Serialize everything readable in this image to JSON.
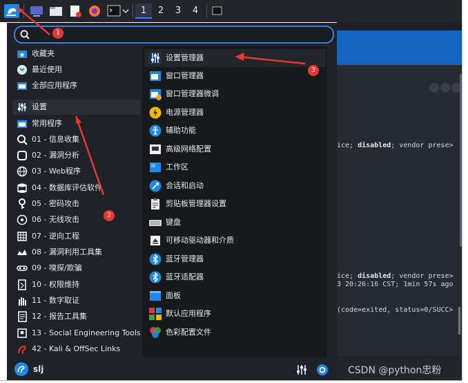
{
  "panel": {
    "workspaces": [
      "1",
      "2",
      "3",
      "4"
    ]
  },
  "search": {
    "placeholder": "",
    "value": ""
  },
  "categories": [
    {
      "label": "收藏夹",
      "icon": "star-folder-icon"
    },
    {
      "label": "最近使用",
      "icon": "recent-icon"
    },
    {
      "label": "全部应用程序",
      "icon": "all-apps-icon"
    },
    {
      "label": "设置",
      "icon": "settings-sliders-icon"
    },
    {
      "label": "常用程序",
      "icon": "common-apps-icon"
    },
    {
      "label": "01 - 信息收集",
      "icon": "magnifier-icon"
    },
    {
      "label": "02 - 漏洞分析",
      "icon": "vuln-icon"
    },
    {
      "label": "03 - Web程序",
      "icon": "web-icon"
    },
    {
      "label": "04 - 数据库评估软件",
      "icon": "database-icon"
    },
    {
      "label": "05 - 密码攻击",
      "icon": "key-icon"
    },
    {
      "label": "06 - 无线攻击",
      "icon": "wireless-icon"
    },
    {
      "label": "07 - 逆向工程",
      "icon": "reverse-icon"
    },
    {
      "label": "08 - 漏洞利用工具集",
      "icon": "exploit-icon"
    },
    {
      "label": "09 - 嗅探/欺骗",
      "icon": "sniff-icon"
    },
    {
      "label": "10 - 权限维持",
      "icon": "persistence-icon"
    },
    {
      "label": "11 - 数字取证",
      "icon": "forensics-icon"
    },
    {
      "label": "12 - 报告工具集",
      "icon": "report-icon"
    },
    {
      "label": "13 - Social Engineering Tools",
      "icon": "social-icon"
    },
    {
      "label": "42 - Kali & OffSec Links",
      "icon": "kali-icon"
    }
  ],
  "settings_items": [
    {
      "label": "设置管理器",
      "icon": "settings-manager-icon"
    },
    {
      "label": "窗口管理器",
      "icon": "window-manager-icon"
    },
    {
      "label": "窗口管理器微调",
      "icon": "window-tweaks-icon"
    },
    {
      "label": "电源管理器",
      "icon": "power-icon"
    },
    {
      "label": "辅助功能",
      "icon": "accessibility-icon"
    },
    {
      "label": "高级网络配置",
      "icon": "network-icon"
    },
    {
      "label": "工作区",
      "icon": "workspace-icon"
    },
    {
      "label": "会话和启动",
      "icon": "session-icon"
    },
    {
      "label": "剪贴板管理器设置",
      "icon": "clipboard-icon"
    },
    {
      "label": "键盘",
      "icon": "keyboard-icon"
    },
    {
      "label": "可移动驱动器和介质",
      "icon": "removable-drive-icon"
    },
    {
      "label": "蓝牙管理器",
      "icon": "bluetooth-icon"
    },
    {
      "label": "蓝牙适配器",
      "icon": "bluetooth-adapter-icon"
    },
    {
      "label": "面板",
      "icon": "panel-icon"
    },
    {
      "label": "默认应用程序",
      "icon": "default-apps-icon"
    },
    {
      "label": "色彩配置文件",
      "icon": "color-profile-icon"
    }
  ],
  "user": {
    "name": "slj"
  },
  "terminal": {
    "line1_pre": "ice; ",
    "line1_word": "disabled",
    "line1_post": "; vendor prese>",
    "line2_pre": "ice; ",
    "line2_word": "disabled",
    "line2_post": "; vendor prese>",
    "line3": "3 20:26:16 CST; 1min 57s ago",
    "line4": "(code=exited, status=0/SUCC>"
  },
  "annotations": [
    "1",
    "2",
    "3"
  ],
  "watermark": "CSDN @python忠粉",
  "colors": {
    "accent": "#3d7fd9",
    "annotation": "#e53935",
    "menu_bg": "#1f2228"
  }
}
